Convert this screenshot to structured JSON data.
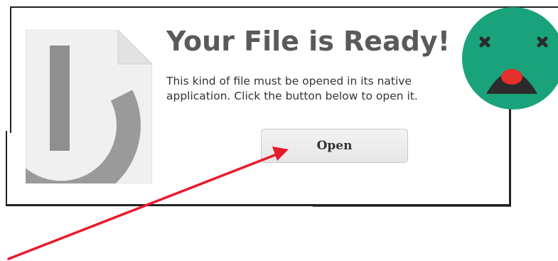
{
  "dialog": {
    "title": "Your File is Ready!",
    "description_line1": "This kind of file must be opened in its native",
    "description_line2": "application. Click the button below to open it.",
    "open_button_label": "Open"
  },
  "overlay": {
    "badge_icon": "dead-face-emoji-icon",
    "badge_color": "#1aa37a",
    "arrow_icon": "red-arrow-icon",
    "arrow_color": "#e8192c"
  },
  "file_icon": "generic-file-power-icon"
}
